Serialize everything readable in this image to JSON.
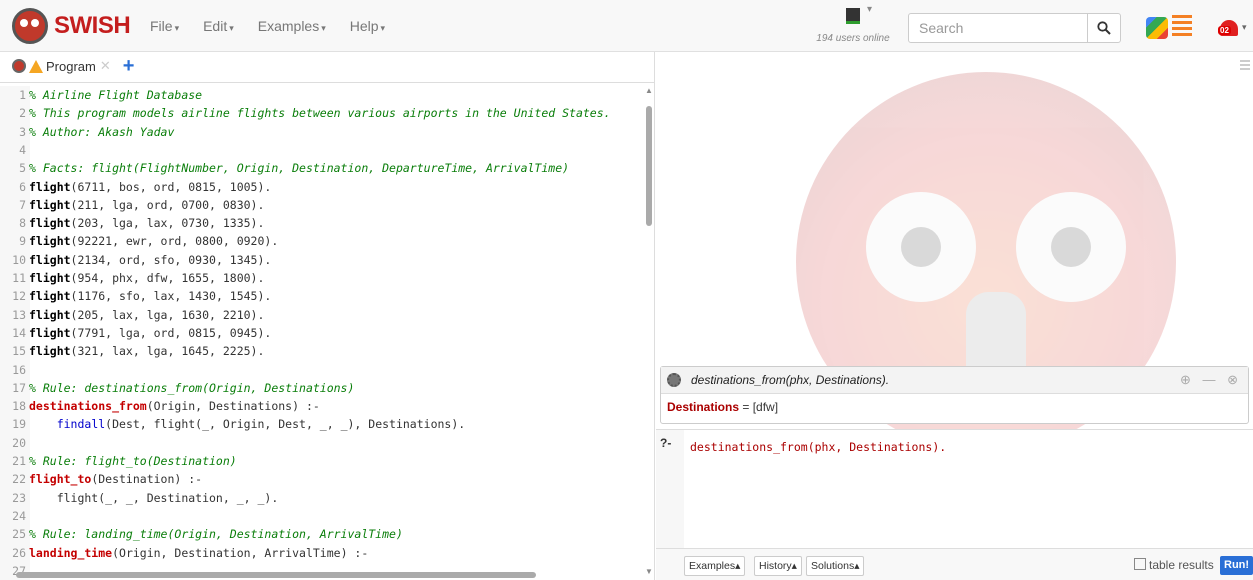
{
  "app": {
    "brand": "SWISH",
    "menu": [
      "File",
      "Edit",
      "Examples",
      "Help"
    ],
    "online_text": "194 users online",
    "search_placeholder": "Search",
    "notification_badge": "02"
  },
  "tab": {
    "label": "Program",
    "close": "✕",
    "add": "+"
  },
  "code_lines": [
    {
      "n": "1",
      "t": "% Airline Flight Database",
      "type": "comment"
    },
    {
      "n": "2",
      "t": "% This program models airline flights between various airports in the United States.",
      "type": "comment"
    },
    {
      "n": "3",
      "t": "% Author: Akash Yadav",
      "type": "comment"
    },
    {
      "n": "4",
      "t": "",
      "type": "blank"
    },
    {
      "n": "5",
      "t": "% Facts: flight(FlightNumber, Origin, Destination, DepartureTime, ArrivalTime)",
      "type": "comment"
    },
    {
      "n": "6",
      "t": "flight(6711, bos, ord, 0815, 1005).",
      "type": "fact"
    },
    {
      "n": "7",
      "t": "flight(211, lga, ord, 0700, 0830).",
      "type": "fact"
    },
    {
      "n": "8",
      "t": "flight(203, lga, lax, 0730, 1335).",
      "type": "fact"
    },
    {
      "n": "9",
      "t": "flight(92221, ewr, ord, 0800, 0920).",
      "type": "fact"
    },
    {
      "n": "10",
      "t": "flight(2134, ord, sfo, 0930, 1345).",
      "type": "fact"
    },
    {
      "n": "11",
      "t": "flight(954, phx, dfw, 1655, 1800).",
      "type": "fact"
    },
    {
      "n": "12",
      "t": "flight(1176, sfo, lax, 1430, 1545).",
      "type": "fact"
    },
    {
      "n": "13",
      "t": "flight(205, lax, lga, 1630, 2210).",
      "type": "fact"
    },
    {
      "n": "14",
      "t": "flight(7791, lga, ord, 0815, 0945).",
      "type": "fact"
    },
    {
      "n": "15",
      "t": "flight(321, lax, lga, 1645, 2225).",
      "type": "fact"
    },
    {
      "n": "16",
      "t": "",
      "type": "blank"
    },
    {
      "n": "17",
      "t": "% Rule: destinations_from(Origin, Destinations)",
      "type": "comment"
    },
    {
      "n": "18",
      "t": "destinations_from(Origin, Destinations) :-",
      "type": "head"
    },
    {
      "n": "19",
      "t": "    findall(Dest, flight(_, Origin, Dest, _, _), Destinations).",
      "type": "body"
    },
    {
      "n": "20",
      "t": "",
      "type": "blank"
    },
    {
      "n": "21",
      "t": "% Rule: flight_to(Destination)",
      "type": "comment"
    },
    {
      "n": "22",
      "t": "flight_to(Destination) :-",
      "type": "head"
    },
    {
      "n": "23",
      "t": "    flight(_, _, Destination, _, _).",
      "type": "body"
    },
    {
      "n": "24",
      "t": "",
      "type": "blank"
    },
    {
      "n": "25",
      "t": "% Rule: landing_time(Origin, Destination, ArrivalTime)",
      "type": "comment"
    },
    {
      "n": "26",
      "t": "landing_time(Origin, Destination, ArrivalTime) :-",
      "type": "head"
    },
    {
      "n": "27",
      "t": "",
      "type": "blank"
    }
  ],
  "query_result": {
    "query": "destinations_from(phx, Destinations).",
    "answer_var": "Destinations",
    "answer_rest": " = [dfw]"
  },
  "query_editor": {
    "prompt": "?-",
    "query": "destinations_from(phx, Destinations).",
    "buttons": [
      "Examples▴",
      "History▴",
      "Solutions▴"
    ],
    "table_results_label": "table results",
    "run_label": "Run!"
  }
}
